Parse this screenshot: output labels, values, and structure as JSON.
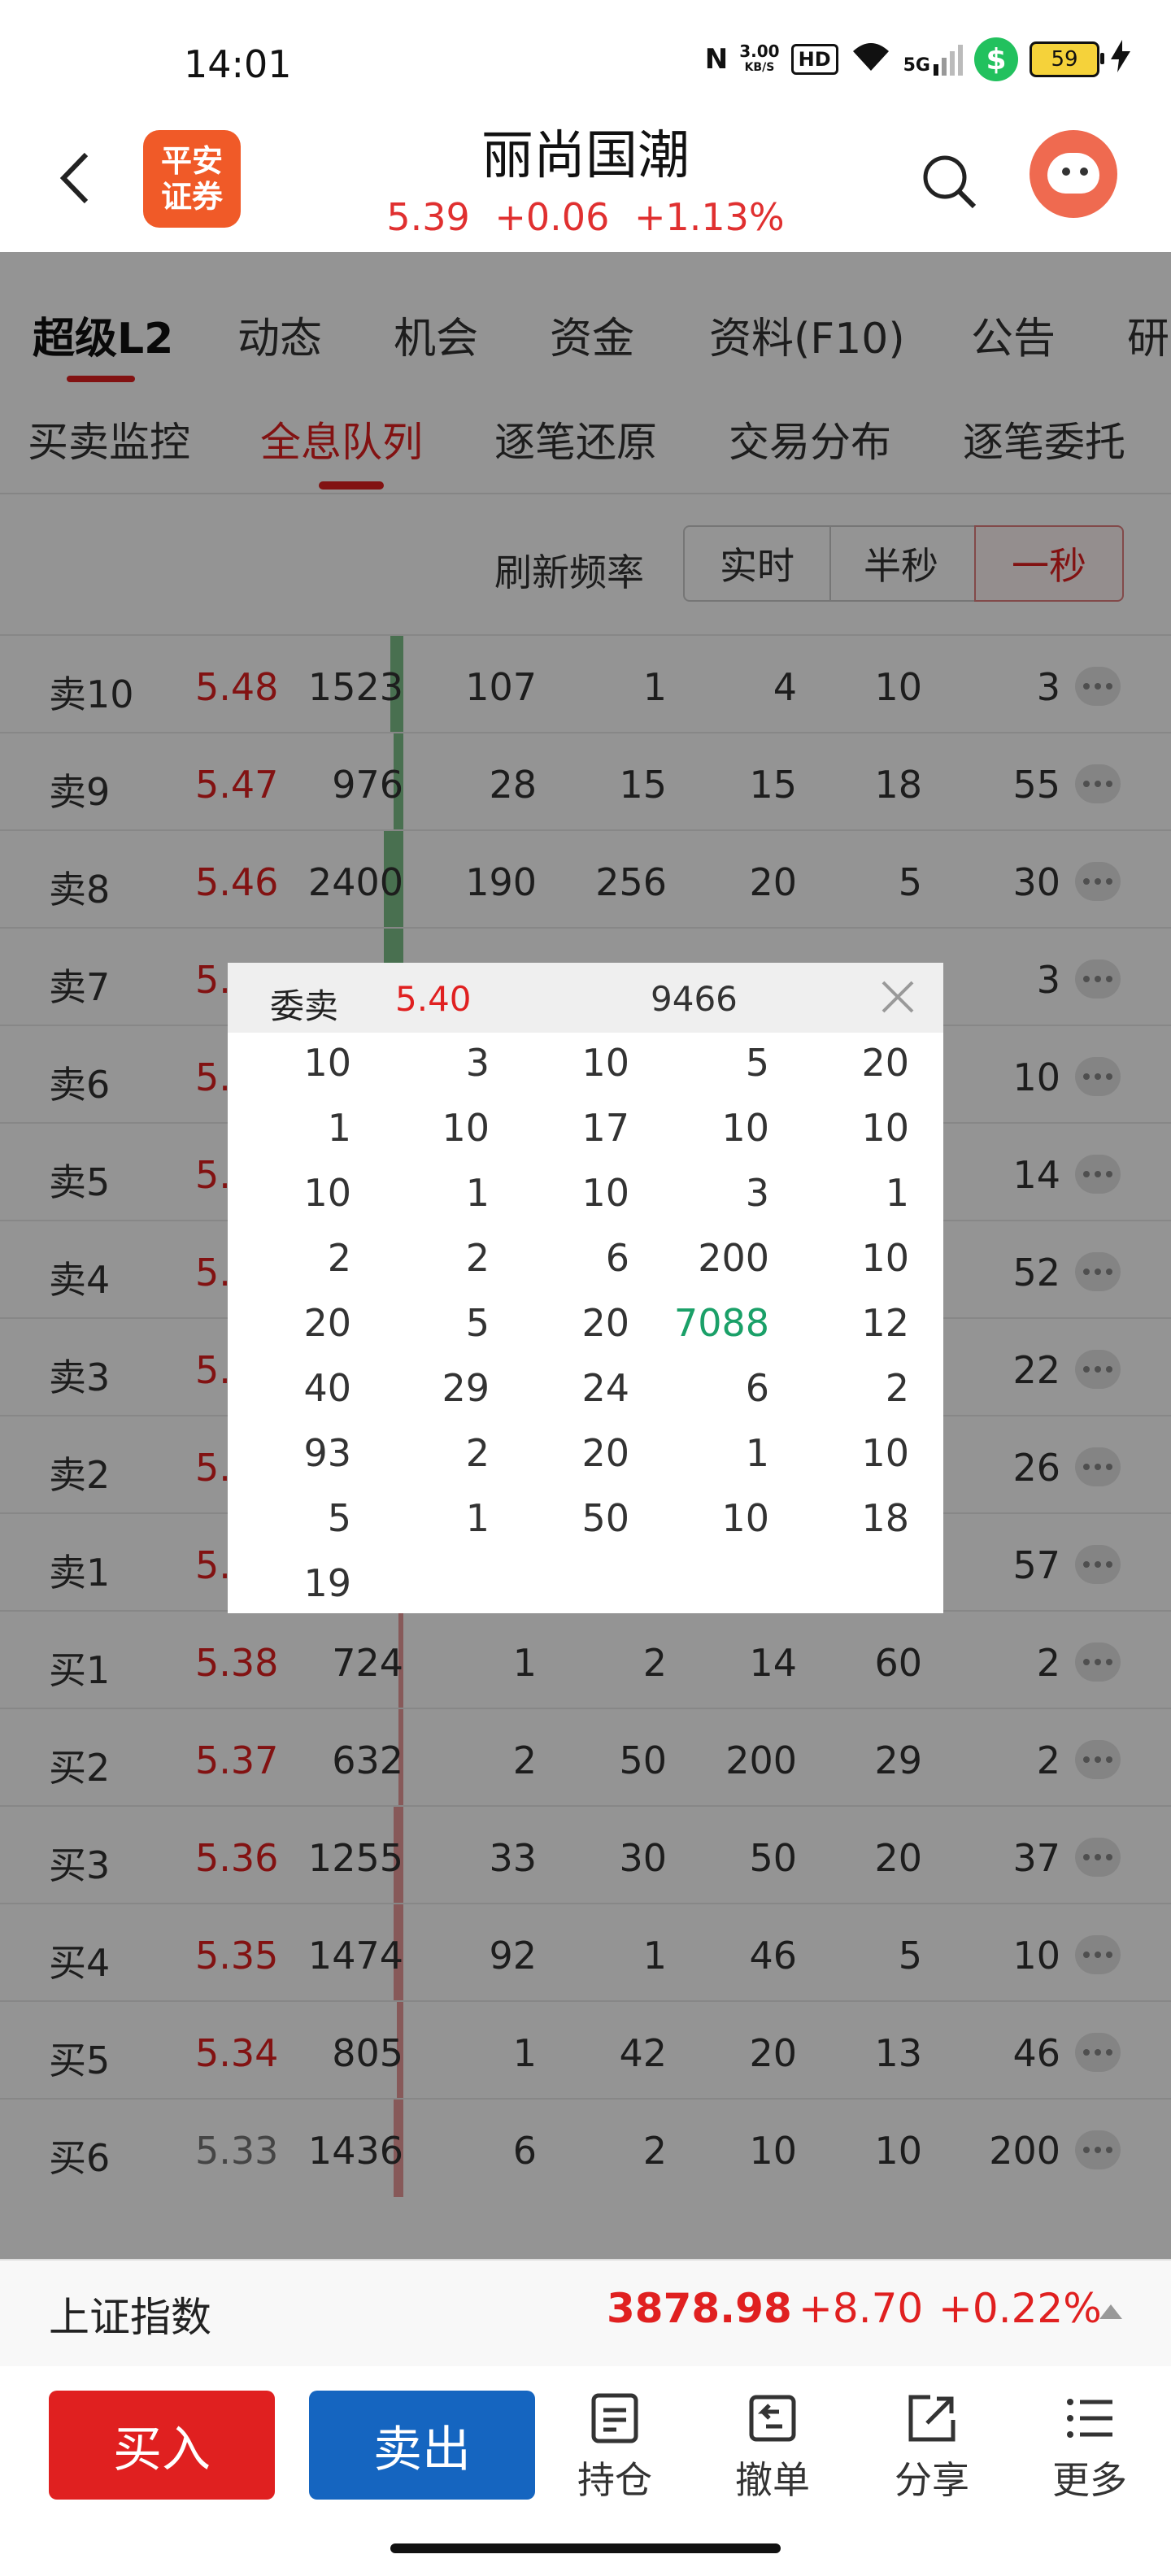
{
  "status_bar": {
    "time": "14:01",
    "net_speed_value": "3.00",
    "net_speed_unit": "KB/S",
    "hd_badge": "HD",
    "signal_label": "5G",
    "battery": "59",
    "wechat_icon": "wechat-pay-icon"
  },
  "header": {
    "logo_line1": "平安",
    "logo_line2": "证券",
    "title": "丽尚国潮",
    "price": "5.39",
    "change": "+0.06",
    "change_pct": "+1.13%"
  },
  "tabs_main": [
    "超级L2",
    "动态",
    "机会",
    "资金",
    "资料(F10)",
    "公告",
    "研"
  ],
  "tabs_sub": [
    "买卖监控",
    "全息队列",
    "逐笔还原",
    "交易分布",
    "逐笔委托"
  ],
  "refresh": {
    "label": "刷新频率",
    "options": [
      "实时",
      "半秒",
      "一秒"
    ],
    "selected": "一秒"
  },
  "order_book": [
    {
      "label": "卖10",
      "price": "5.48",
      "vol": "1523",
      "q": [
        "107",
        "1",
        "4",
        "10",
        "3"
      ],
      "bar": 0.08
    },
    {
      "label": "卖9",
      "price": "5.47",
      "vol": "976",
      "q": [
        "28",
        "15",
        "15",
        "18",
        "55"
      ],
      "bar": 0.06
    },
    {
      "label": "卖8",
      "price": "5.46",
      "vol": "2400",
      "q": [
        "190",
        "256",
        "20",
        "5",
        "30"
      ],
      "bar": 0.12
    },
    {
      "label": "卖7",
      "price": "5.45",
      "vol": "",
      "q": [
        "",
        "",
        "",
        "",
        "3"
      ],
      "bar": 0.12
    },
    {
      "label": "卖6",
      "price": "5.44",
      "vol": "",
      "q": [
        "",
        "",
        "",
        "",
        "10"
      ],
      "bar": 0.12
    },
    {
      "label": "卖5",
      "price": "5.43",
      "vol": "",
      "q": [
        "",
        "",
        "",
        "",
        "14"
      ],
      "bar": 0.12
    },
    {
      "label": "卖4",
      "price": "5.42",
      "vol": "",
      "q": [
        "",
        "",
        "",
        "",
        "52"
      ],
      "bar": 0.12
    },
    {
      "label": "卖3",
      "price": "5.41",
      "vol": "",
      "q": [
        "",
        "",
        "",
        "",
        "22"
      ],
      "bar": 0.12
    },
    {
      "label": "卖2",
      "price": "5.40",
      "vol": "",
      "q": [
        "",
        "",
        "",
        "",
        "26"
      ],
      "bar": 0.4
    },
    {
      "label": "卖1",
      "price": "5.39",
      "vol": "",
      "q": [
        "",
        "",
        "",
        "",
        "57"
      ],
      "bar": 0.4
    },
    {
      "label": "买1",
      "price": "5.38",
      "vol": "724",
      "q": [
        "1",
        "2",
        "14",
        "60",
        "2"
      ],
      "bar": 0.03
    },
    {
      "label": "买2",
      "price": "5.37",
      "vol": "632",
      "q": [
        "2",
        "50",
        "200",
        "29",
        "2"
      ],
      "bar": 0.03
    },
    {
      "label": "买3",
      "price": "5.36",
      "vol": "1255",
      "q": [
        "33",
        "30",
        "50",
        "20",
        "37"
      ],
      "bar": 0.06
    },
    {
      "label": "买4",
      "price": "5.35",
      "vol": "1474",
      "q": [
        "92",
        "1",
        "46",
        "5",
        "10"
      ],
      "bar": 0.06
    },
    {
      "label": "买5",
      "price": "5.34",
      "vol": "805",
      "q": [
        "1",
        "42",
        "20",
        "13",
        "46"
      ],
      "bar": 0.04
    },
    {
      "label": "买6",
      "price": "5.33",
      "vol": "1436",
      "q": [
        "6",
        "2",
        "10",
        "10",
        "200"
      ],
      "bar": 0.06
    }
  ],
  "popup": {
    "title": "委卖",
    "price": "5.40",
    "total": "9466",
    "orders": [
      "10",
      "3",
      "10",
      "5",
      "20",
      "1",
      "10",
      "17",
      "10",
      "10",
      "10",
      "1",
      "10",
      "3",
      "1",
      "2",
      "2",
      "6",
      "200",
      "10",
      "20",
      "5",
      "20",
      "7088",
      "12",
      "40",
      "29",
      "24",
      "6",
      "2",
      "93",
      "2",
      "20",
      "1",
      "10",
      "5",
      "1",
      "50",
      "10",
      "18",
      "19"
    ],
    "highlight": "7088"
  },
  "index": {
    "name": "上证指数",
    "value": "3878.98",
    "change": "+8.70",
    "change_pct": "+0.22%"
  },
  "bottom": {
    "buy": "买入",
    "sell": "卖出",
    "actions": [
      {
        "label": "持仓",
        "icon": "holdings-icon"
      },
      {
        "label": "撤单",
        "icon": "cancel-order-icon"
      },
      {
        "label": "分享",
        "icon": "share-icon"
      },
      {
        "label": "更多",
        "icon": "more-icon"
      }
    ]
  }
}
